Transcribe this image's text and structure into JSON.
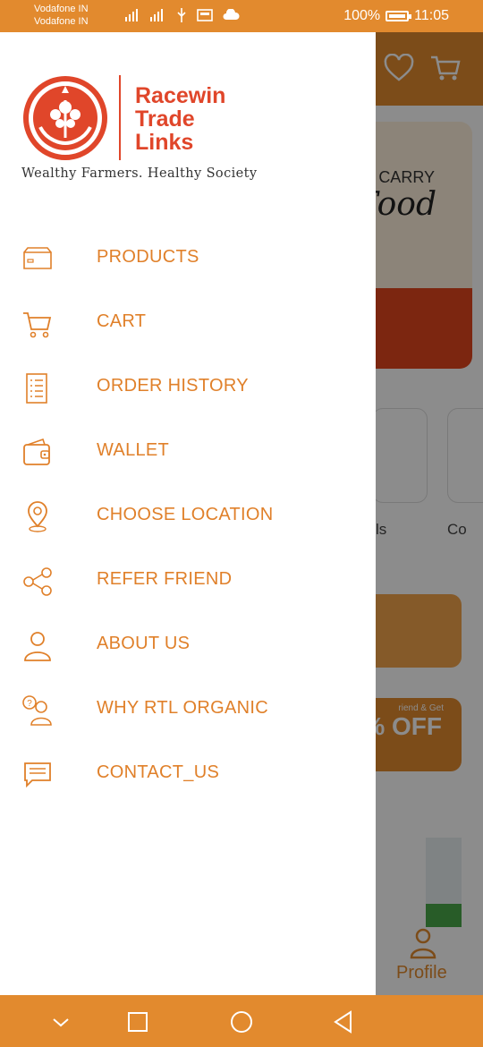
{
  "status_bar": {
    "carrier_1": "Vodafone IN",
    "carrier_2": "Vodafone IN",
    "battery": "100%",
    "time": "11:05"
  },
  "background_app": {
    "banner_text_1": "CARRY",
    "banner_text_2": "Food",
    "category_label_1": "ls",
    "category_label_2": "Co",
    "offer_small": "riend & Get",
    "offer_big": "% OFF",
    "profile_label": "Profile"
  },
  "drawer": {
    "brand_line_1": "Racewin",
    "brand_line_2": "Trade",
    "brand_line_3": "Links",
    "tagline": "Wealthy Farmers. Healthy Society",
    "menu": [
      {
        "label": "PRODUCTS",
        "icon": "box-icon"
      },
      {
        "label": "CART",
        "icon": "cart-icon"
      },
      {
        "label": "ORDER HISTORY",
        "icon": "list-document-icon"
      },
      {
        "label": "WALLET",
        "icon": "wallet-icon"
      },
      {
        "label": "CHOOSE LOCATION",
        "icon": "location-pin-icon"
      },
      {
        "label": "REFER FRIEND",
        "icon": "share-people-icon"
      },
      {
        "label": "ABOUT US",
        "icon": "user-icon"
      },
      {
        "label": "WHY RTL ORGANIC",
        "icon": "question-person-icon"
      },
      {
        "label": "CONTACT_US",
        "icon": "chat-icon"
      }
    ]
  },
  "colors": {
    "accent": "#e28a2e",
    "brand_red": "#e0462a",
    "menu_text": "#e0802a"
  }
}
